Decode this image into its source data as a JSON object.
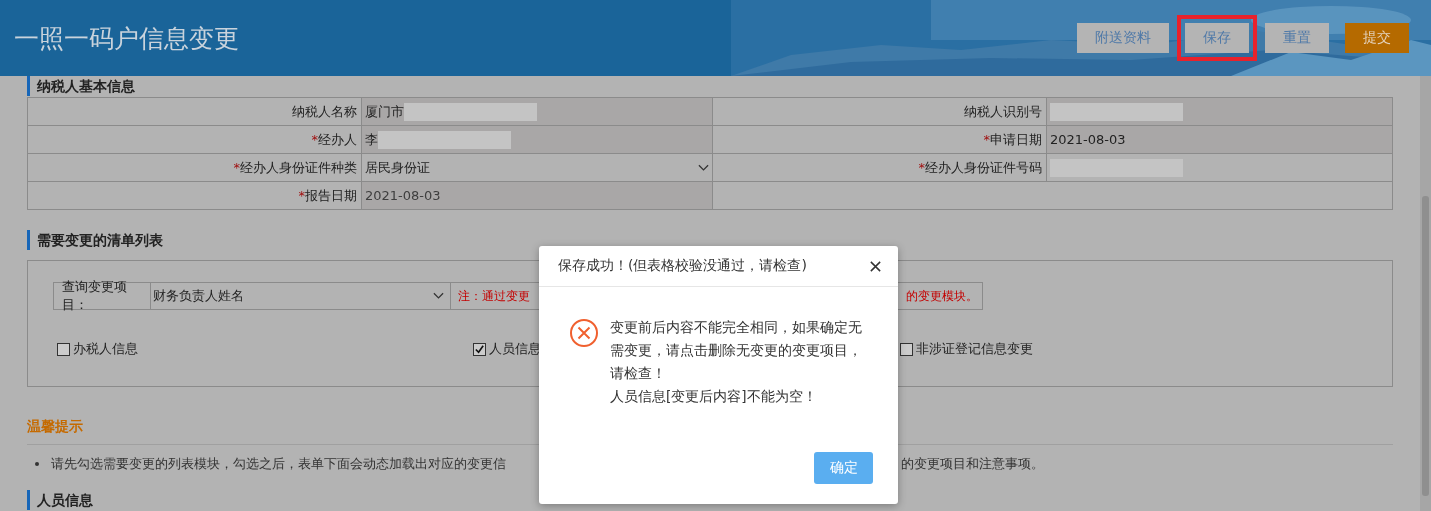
{
  "header": {
    "title": "一照一码户信息变更",
    "buttons": [
      {
        "label": "附送资料",
        "kind": "plain",
        "highlighted": false
      },
      {
        "label": "保存",
        "kind": "plain",
        "highlighted": true
      },
      {
        "label": "重置",
        "kind": "plain",
        "highlighted": false
      },
      {
        "label": "提交",
        "kind": "primary",
        "highlighted": false
      }
    ]
  },
  "basic_info": {
    "heading": "纳税人基本信息",
    "rows": [
      [
        {
          "label": "纳税人名称",
          "kind": "text",
          "value": "厦门市",
          "redacted": true,
          "readonly": true
        },
        {
          "label": "纳税人识别号",
          "kind": "text",
          "redacted": true,
          "readonly": true
        }
      ],
      [
        {
          "label": "经办人",
          "mark": "*",
          "kind": "text",
          "value": "李",
          "redacted": true,
          "readonly": true
        },
        {
          "label": "申请日期",
          "mark": "*",
          "kind": "text",
          "value": "2021-08-03",
          "redacted": false,
          "readonly": true
        }
      ],
      [
        {
          "label": "经办人身份证件种类",
          "mark": "*",
          "kind": "select",
          "value": "居民身份证",
          "redacted": false,
          "readonly": false
        },
        {
          "label": "经办人身份证件号码",
          "mark": "*",
          "kind": "text",
          "redacted": true,
          "readonly": false
        }
      ],
      [
        {
          "label": "报告日期",
          "mark": "*",
          "kind": "disabled",
          "value": "2021-08-03",
          "redacted": false,
          "readonly": true
        },
        {
          "kind": "empty"
        }
      ]
    ]
  },
  "changes": {
    "heading": "需要变更的清单列表",
    "query": {
      "label": "查询变更项目：",
      "value": "财务负责人姓名"
    },
    "note_start": "注：通过变更",
    "note_end": "的变更模块。",
    "checkboxes": [
      {
        "label": "办税人信息",
        "checked": false
      },
      {
        "label": "人员信息",
        "checked": true
      },
      {
        "label": "非涉证登记信息变更",
        "checked": false
      }
    ]
  },
  "tips": {
    "heading": "温馨提示",
    "items": [
      {
        "start": "请先勾选需要变更的列表模块，勾选之后，表单下面会动态加载出对应的变更信",
        "end": "的变更项目和注意事项。"
      }
    ]
  },
  "next_heading": "人员信息",
  "modal": {
    "title": "保存成功！(但表格校验没通过，请检查)",
    "messages": [
      "变更前后内容不能完全相同，如果确定无需变更，请点击删除无变更的变更项目，请检查！",
      "人员信息[变更后内容]不能为空！"
    ],
    "button": "确定"
  }
}
